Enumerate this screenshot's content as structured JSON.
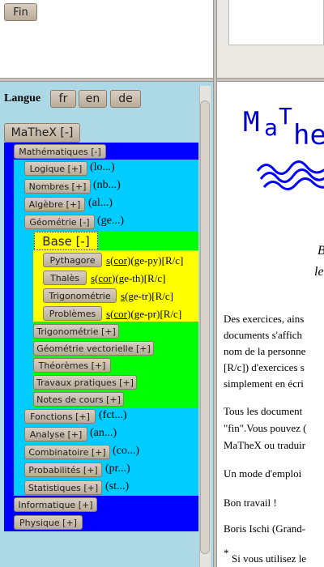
{
  "top_frame": {
    "fin_label": "Fin"
  },
  "langue": {
    "label": "Langue",
    "options": [
      "fr",
      "en",
      "de"
    ]
  },
  "colors": {
    "left_bg": "#add8e6",
    "blue": "#0000ff",
    "cyan": "#00ccff",
    "green": "#00ff00",
    "yellow": "#ffff00",
    "title_blue": "#0000cc"
  },
  "tree": {
    "root": "MaTheX [-]",
    "mathematiques": "Mathématiques [-]",
    "items": [
      {
        "label": "Logique [+]",
        "note": "(lo...)"
      },
      {
        "label": "Nombres [+]",
        "note": "(nb...)"
      },
      {
        "label": "Algèbre [+]",
        "note": "(al...)"
      },
      {
        "label": "Géométrie [-]",
        "note": "(ge...)"
      }
    ],
    "base": "Base [-]",
    "base_items": [
      {
        "label": "Pythagore",
        "s": "s",
        "cor": "cor",
        "rest": "(ge-py)[R/c]"
      },
      {
        "label": "Thalès",
        "s": "s",
        "cor": "cor",
        "rest": "(ge-th)[R/c]"
      },
      {
        "label": "Trigonométrie",
        "s": "s",
        "cor": "",
        "rest": "(ge-tr)[R/c]"
      },
      {
        "label": "Problèmes",
        "s": "s",
        "cor": "cor",
        "rest": "(ge-pr)[R/c]"
      }
    ],
    "geo_items": [
      "Trigonométrie [+]",
      "Géométrie vectorielle [+]",
      "Théorèmes [+]",
      "Travaux pratiques [+]",
      "Notes de cours [+]"
    ],
    "items2": [
      {
        "label": "Fonctions [+]",
        "note": "(fct...)"
      },
      {
        "label": "Analyse [+]",
        "note": "(an...)"
      },
      {
        "label": "Combinatoire [+]",
        "note": "(co...)"
      },
      {
        "label": "Probabilités [+]",
        "note": "(pr...)"
      },
      {
        "label": "Statistiques [+]",
        "note": "(st...)"
      }
    ],
    "informatique": "Informatique [+]",
    "physique": "Physique [+]"
  },
  "right": {
    "title_1": "M",
    "title_2": "a",
    "title_3": "T",
    "title_4": "he",
    "heading_char_1": "B",
    "heading_char_2": "le",
    "paragraphs": [
      "Des exercices, ains",
      "documents s'affich",
      "nom de la personne",
      "[R/c]) d'exercices s",
      "simplement en écri",
      "Tous les document",
      "\"fin\".Vous pouvez (",
      "MaTheX ou traduir",
      "Un mode d'emploi",
      "Bon travail !",
      "Boris Ischi (Grand-",
      "Si vous utilisez le"
    ],
    "footnote_mark": "*"
  }
}
